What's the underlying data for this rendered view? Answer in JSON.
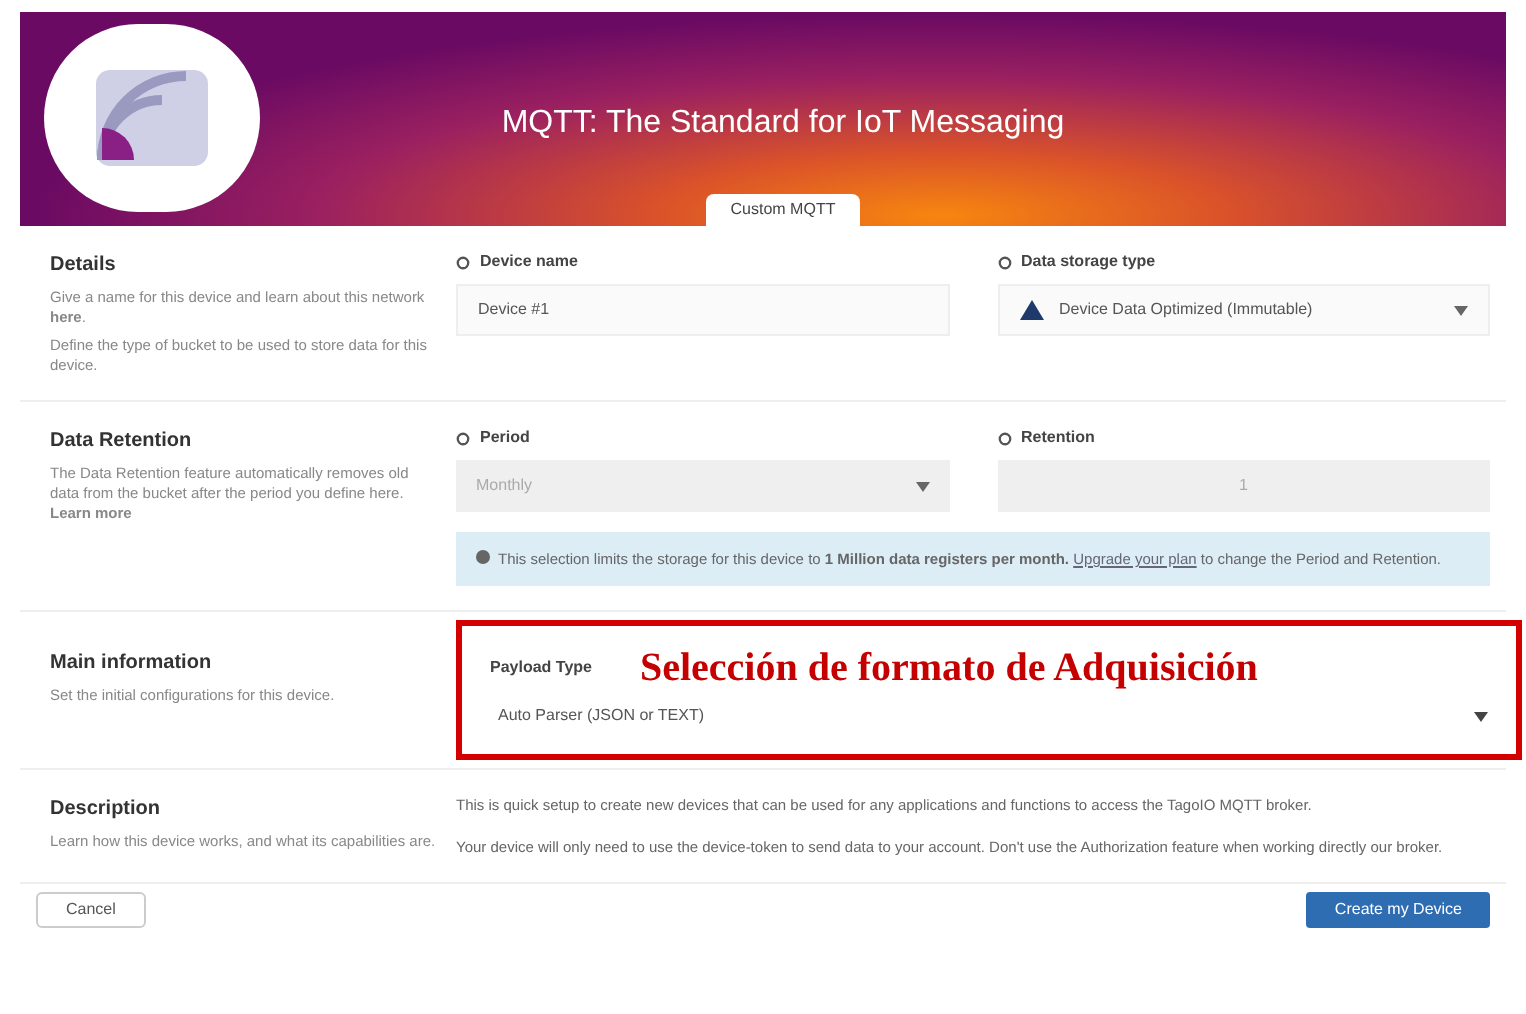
{
  "header": {
    "title": "MQTT: The Standard for IoT Messaging",
    "tabs": [
      {
        "label": "Custom MQTT",
        "selected": true
      }
    ]
  },
  "sections": [
    {
      "kind": "details",
      "title": "Details",
      "paragraphs": [
        "Give a name for this device and learn about this network **here**.",
        "Define the type of bucket to be used to store data for this device."
      ],
      "fields": [
        {
          "kind": "input",
          "label": "Device name",
          "value": "Device #1"
        },
        {
          "kind": "select",
          "label": "Data storage type",
          "value": "Device Data Optimized (Immutable)"
        }
      ]
    },
    {
      "kind": "retention",
      "title": "Data Retention",
      "paragraphs": [
        "The Data Retention feature automatically removes old data from the bucket after the period you define here. **Learn more**"
      ],
      "fields": [
        {
          "kind": "select",
          "label": "Period",
          "value": "Monthly",
          "disabled": true
        },
        {
          "kind": "input",
          "label": "Retention",
          "value": "1",
          "disabled": true
        }
      ],
      "alert": {
        "text": "This selection limits the storage for this device to **1 Million data registers per month.**",
        "link": "Upgrade your plan",
        "rest": "to change the Period and Retention."
      }
    },
    {
      "kind": "main",
      "title": "Main information",
      "paragraphs": [
        "Set the initial configurations for this device."
      ],
      "fields": [
        {
          "kind": "select",
          "label": "Payload Type",
          "value": "Auto Parser (JSON or TEXT)"
        }
      ],
      "annotation": "Selección de formato de Adquisición"
    },
    {
      "kind": "description",
      "title": "Description",
      "paragraphs": [
        "Learn how this device works, and what its capabilities are."
      ],
      "body": [
        "This is quick setup to create new devices that can be used for any applications and functions to access the TagoIO MQTT broker.",
        "Your device will only need to use the device-token to send data to your account. Don't use the Authorization feature when working directly our broker."
      ]
    }
  ],
  "footer": {
    "cancel": "Cancel",
    "create": "Create my Device"
  }
}
